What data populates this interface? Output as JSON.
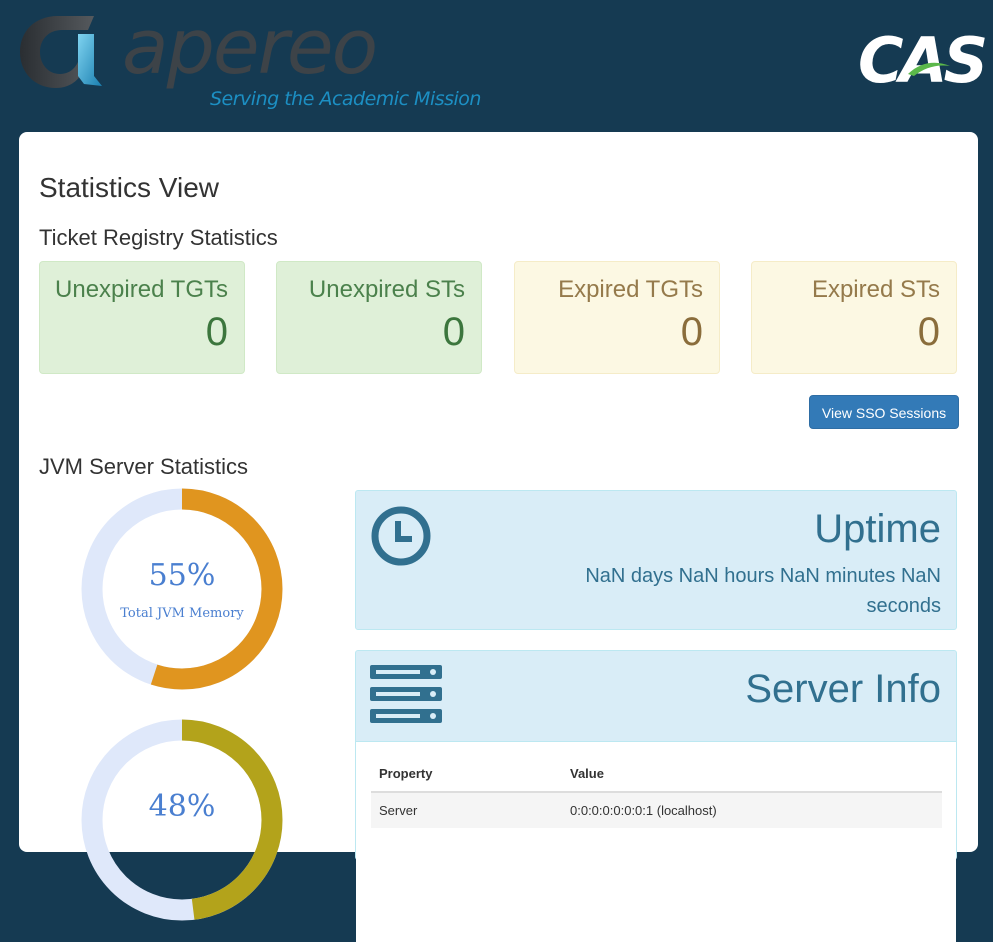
{
  "header": {
    "brand_name": "apereo",
    "brand_tagline": "Serving the Academic Mission",
    "product_logo": "CAS"
  },
  "page_title": "Statistics View",
  "ticket_registry": {
    "title": "Ticket Registry Statistics",
    "stats": [
      {
        "label": "Unexpired TGTs",
        "value": "0",
        "status": "success"
      },
      {
        "label": "Unexpired STs",
        "value": "0",
        "status": "success"
      },
      {
        "label": "Expired TGTs",
        "value": "0",
        "status": "warning"
      },
      {
        "label": "Expired STs",
        "value": "0",
        "status": "warning"
      }
    ],
    "sso_button_label": "View SSO Sessions"
  },
  "jvm": {
    "title": "JVM Server Statistics",
    "gauges": [
      {
        "percent_label": "55%",
        "fraction": 0.55,
        "caption": "Total JVM Memory",
        "color": "#e0951f"
      },
      {
        "percent_label": "48%",
        "fraction": 0.48,
        "caption": "",
        "color": "#b3a31b"
      }
    ],
    "gauge_track_color": "#dfe8fa"
  },
  "uptime": {
    "icon": "clock-icon",
    "title": "Uptime",
    "value": "NaN days NaN hours NaN minutes NaN seconds"
  },
  "server_info": {
    "icon": "server-icon",
    "title": "Server Info",
    "columns": [
      "Property",
      "Value"
    ],
    "rows": [
      [
        "Server",
        "0:0:0:0:0:0:0:1 (localhost)"
      ]
    ]
  },
  "colors": {
    "background": "#153a52",
    "info_text": "#31708f",
    "primary_button": "#337ab7"
  }
}
